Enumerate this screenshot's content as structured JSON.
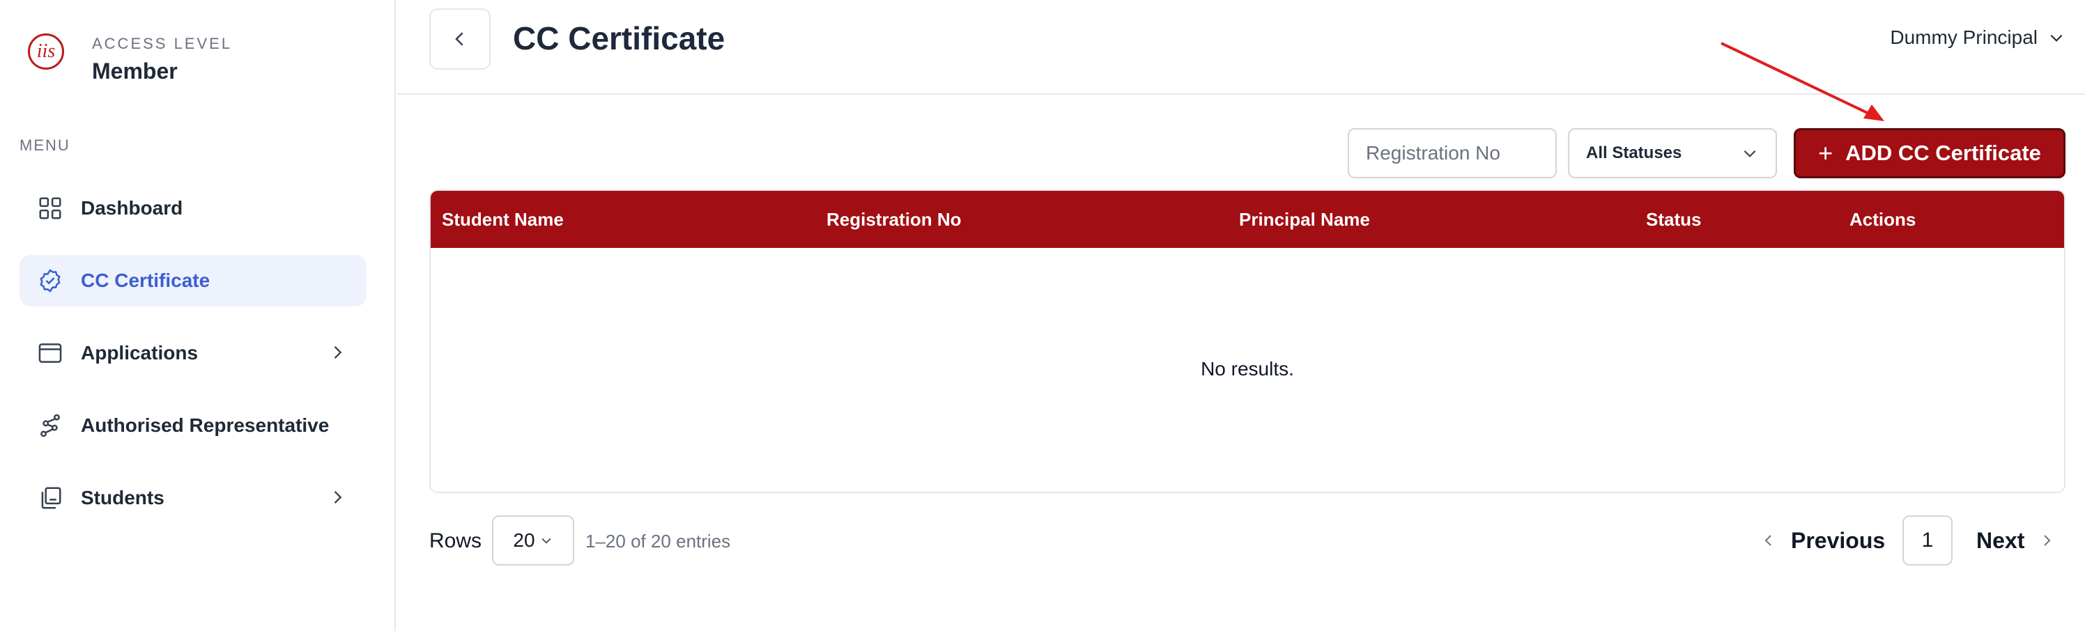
{
  "brand": {
    "logo_text": "iis",
    "access_label": "ACCESS LEVEL",
    "access_value": "Member"
  },
  "sidebar": {
    "menu_label": "MENU",
    "items": [
      {
        "label": "Dashboard",
        "icon": "grid-icon",
        "active": false,
        "has_chevron": false
      },
      {
        "label": "CC Certificate",
        "icon": "badge-check-icon",
        "active": true,
        "has_chevron": false
      },
      {
        "label": "Applications",
        "icon": "window-icon",
        "active": false,
        "has_chevron": true
      },
      {
        "label": "Authorised Representative",
        "icon": "route-icon",
        "active": false,
        "has_chevron": false
      },
      {
        "label": "Students",
        "icon": "copy-icon",
        "active": false,
        "has_chevron": true
      }
    ]
  },
  "header": {
    "title": "CC Certificate",
    "user_name": "Dummy Principal"
  },
  "toolbar": {
    "search_placeholder": "Registration No",
    "search_value": "",
    "status_selected": "All Statuses",
    "add_button_label": "ADD CC Certificate"
  },
  "table": {
    "columns": [
      "Student Name",
      "Registration No",
      "Principal Name",
      "Status",
      "Actions"
    ],
    "rows": [],
    "empty_message": "No results."
  },
  "pagination": {
    "rows_label": "Rows",
    "rows_per_page": "20",
    "entries_text": "1–20 of 20 entries",
    "previous_label": "Previous",
    "current_page": "1",
    "next_label": "Next"
  },
  "colors": {
    "primary": "#a10e13",
    "active_nav_bg": "#eef2fc",
    "active_nav_text": "#3b5fd0",
    "annotation_arrow": "#e11d1d"
  }
}
